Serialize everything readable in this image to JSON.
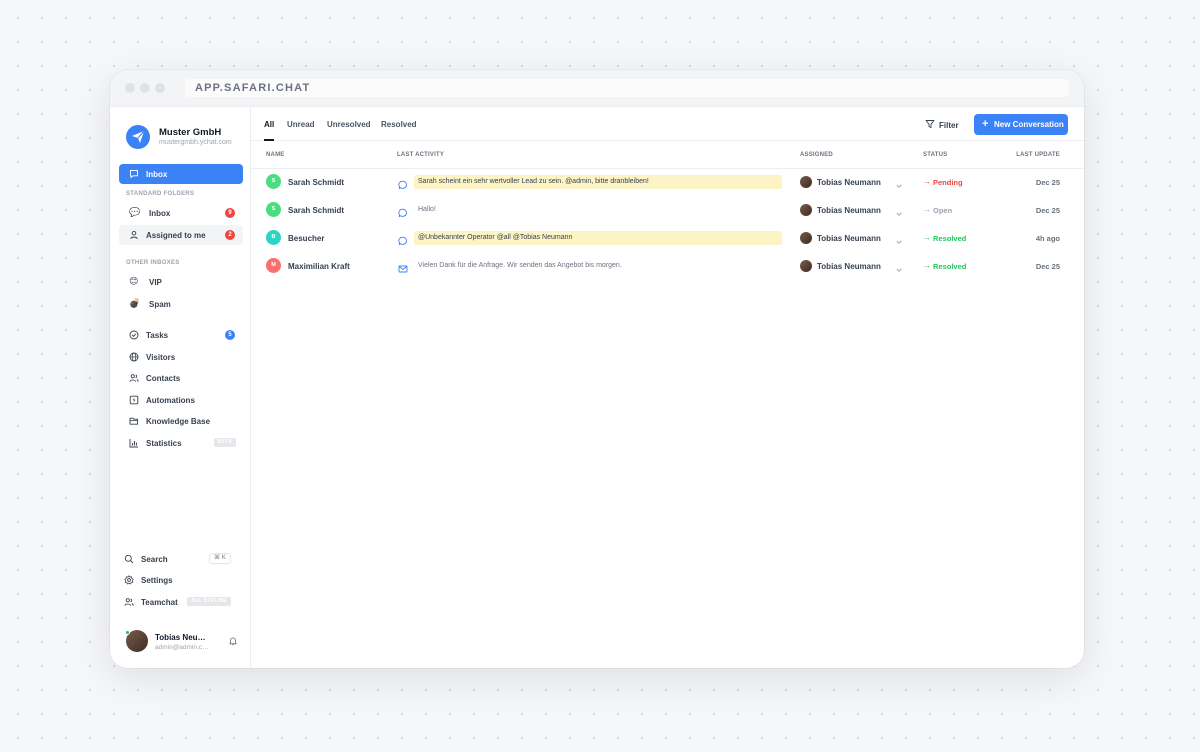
{
  "browser": {
    "url": "APP.SAFARI.CHAT"
  },
  "org": {
    "name": "Muster GmbH",
    "domain": "mustergmbh.ychat.com"
  },
  "sidebar": {
    "top": {
      "label": "Inbox"
    },
    "standard_folders_label": "STANDARD FOLDERS",
    "standard": [
      {
        "label": "Inbox",
        "badge": "9"
      },
      {
        "label": "Assigned to me",
        "badge": "2"
      }
    ],
    "other_inboxes_label": "OTHER INBOXES",
    "other": [
      {
        "label": "VIP",
        "icon": "😊"
      },
      {
        "label": "Spam",
        "icon": "💣"
      }
    ],
    "tools": [
      {
        "label": "Tasks",
        "badge": "5"
      },
      {
        "label": "Visitors"
      },
      {
        "label": "Contacts"
      },
      {
        "label": "Automations"
      },
      {
        "label": "Knowledge Base"
      },
      {
        "label": "Statistics",
        "tag": "BETA"
      }
    ],
    "bottom": [
      {
        "label": "Search",
        "shortcut": "⌘ K"
      },
      {
        "label": "Settings"
      },
      {
        "label": "Teamchat",
        "tag": "ALL OFFLINE"
      }
    ],
    "user": {
      "name": "Tobias Neumann",
      "email": "admin@admin.com"
    }
  },
  "tabs": [
    "All",
    "Unread",
    "Unresolved",
    "Resolved"
  ],
  "toolbar": {
    "filter": "Filter",
    "new_conversation": "New Conversation"
  },
  "table": {
    "headers": {
      "name": "NAME",
      "activity": "LAST ACTIVITY",
      "assigned": "ASSIGNED",
      "status": "STATUS",
      "update": "LAST UPDATE"
    },
    "rows": [
      {
        "initial": "S",
        "avatar_color": "#4ade80",
        "name": "Sarah Schmidt",
        "channel": "chat",
        "message": "Sarah scheint ein sehr wertvoller Lead zu sein. @admin, bitte dranbleiben!",
        "highlight": true,
        "assignee": "Tobias Neumann",
        "status": "Pending",
        "status_color": "#ef4444",
        "updated": "Dec 25"
      },
      {
        "initial": "S",
        "avatar_color": "#4ade80",
        "name": "Sarah Schmidt",
        "channel": "chat",
        "message": "Hallo!",
        "highlight": false,
        "assignee": "Tobias Neumann",
        "status": "Open",
        "status_color": "#9ca3af",
        "updated": "Dec 25"
      },
      {
        "initial": "B",
        "avatar_color": "#2dd4bf",
        "name": "Besucher",
        "channel": "chat",
        "message": "@Unbekannter Operator @all @Tobias Neumann",
        "highlight": true,
        "assignee": "Tobias Neumann",
        "status": "Resolved",
        "status_color": "#22c55e",
        "updated": "4h ago"
      },
      {
        "initial": "M",
        "avatar_color": "#f87171",
        "name": "Maximilian Kraft",
        "channel": "mail",
        "message": "Vielen Dank für die Anfrage. Wir senden das Angebot bis morgen.",
        "highlight": false,
        "assignee": "Tobias Neumann",
        "status": "Resolved",
        "status_color": "#22c55e",
        "updated": "Dec 25"
      }
    ]
  },
  "colors": {
    "accent": "#3b82f6",
    "pending": "#ef4444",
    "resolved": "#22c55e",
    "highlight": "#fdf4c5"
  }
}
